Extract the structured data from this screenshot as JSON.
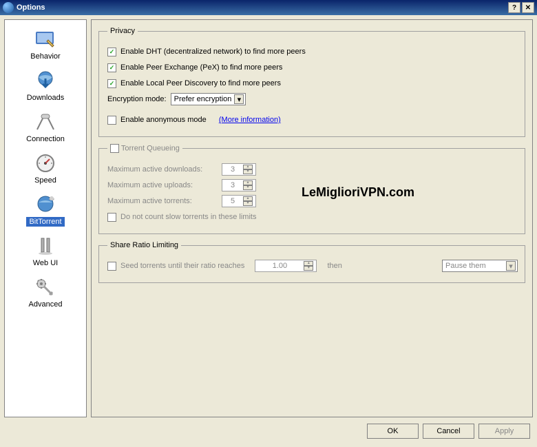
{
  "window": {
    "title": "Options"
  },
  "sidebar": {
    "items": [
      {
        "label": "Behavior"
      },
      {
        "label": "Downloads"
      },
      {
        "label": "Connection"
      },
      {
        "label": "Speed"
      },
      {
        "label": "BitTorrent"
      },
      {
        "label": "Web UI"
      },
      {
        "label": "Advanced"
      }
    ]
  },
  "privacy": {
    "legend": "Privacy",
    "dht": {
      "checked": true,
      "label": "Enable DHT (decentralized network) to find more peers"
    },
    "pex": {
      "checked": true,
      "label": "Enable Peer Exchange (PeX) to find more peers"
    },
    "lpd": {
      "checked": true,
      "label": "Enable Local Peer Discovery to find more peers"
    },
    "enc_label": "Encryption mode:",
    "enc_value": "Prefer encryption",
    "anon": {
      "checked": false,
      "label": "Enable anonymous mode"
    },
    "more_info": "(More information)"
  },
  "queue": {
    "enabled": false,
    "legend": "Torrent Queueing",
    "max_dl_label": "Maximum active downloads:",
    "max_dl": "3",
    "max_up_label": "Maximum active uploads:",
    "max_up": "3",
    "max_tr_label": "Maximum active torrents:",
    "max_tr": "5",
    "slow_label": "Do not count slow torrents in these limits"
  },
  "share": {
    "legend": "Share Ratio Limiting",
    "seed": {
      "checked": false,
      "label": "Seed torrents until their ratio reaches"
    },
    "ratio": "1.00",
    "then_label": "then",
    "action": "Pause them"
  },
  "footer": {
    "ok": "OK",
    "cancel": "Cancel",
    "apply": "Apply"
  },
  "watermark": "LeMiglioriVPN.com"
}
